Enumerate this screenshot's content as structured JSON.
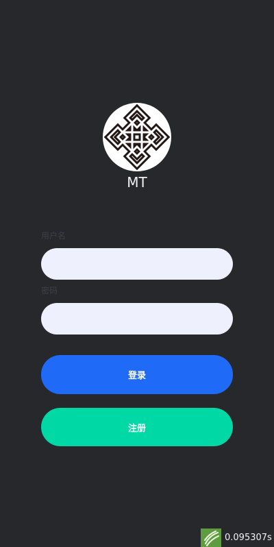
{
  "app": {
    "name": "MT",
    "logo_icon": "diamond-knot-logo-icon"
  },
  "form": {
    "username_label": "用户名",
    "username_value": "",
    "password_label": "密码",
    "password_value": ""
  },
  "buttons": {
    "login_label": "登录",
    "register_label": "注册"
  },
  "overlay": {
    "timer_icon": "stripes-logo-icon",
    "timer_text": "0.095307s"
  },
  "colors": {
    "background": "#26282c",
    "field_background": "#eef0fe",
    "login_button": "#1f6bf7",
    "register_button": "#00d9a5",
    "label_text": "#3d4046"
  }
}
